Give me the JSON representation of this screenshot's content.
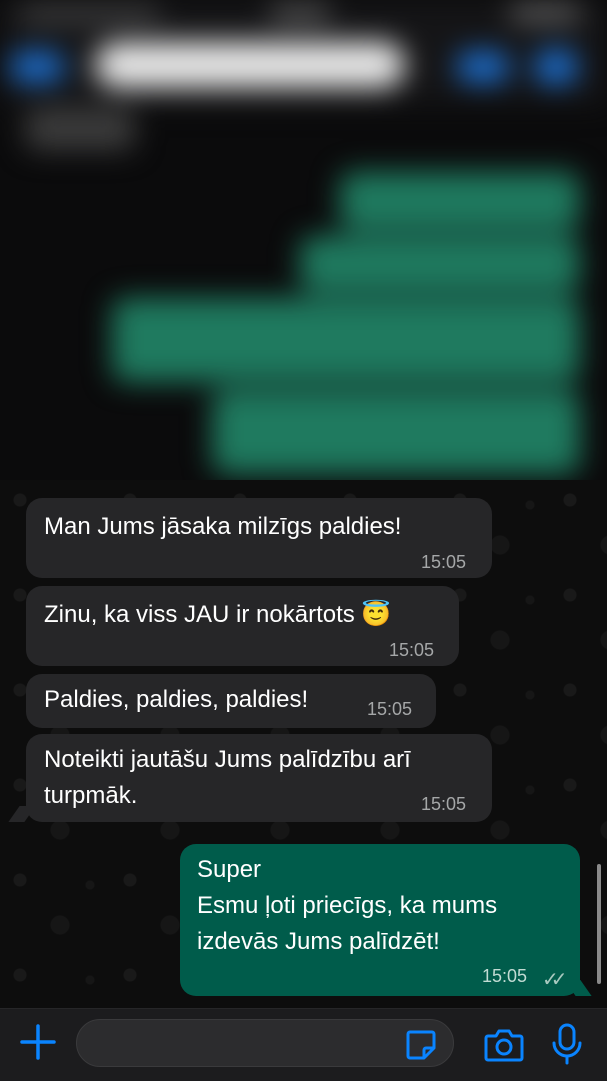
{
  "header": {
    "contact_name": "██████████",
    "contact_status": ""
  },
  "messages": [
    {
      "direction": "incoming",
      "text": "Man Jums jāsaka milzīgs paldies!",
      "time": "15:05"
    },
    {
      "direction": "incoming",
      "text": "Zinu, ka viss JAU ir nokārtots 😇",
      "time": "15:05"
    },
    {
      "direction": "incoming",
      "text": "Paldies, paldies, paldies!",
      "time": "15:05"
    },
    {
      "direction": "incoming",
      "text": "Noteikti jautāšu Jums palīdzību arī\nturpmāk.",
      "time": "15:05"
    },
    {
      "direction": "outgoing",
      "text": "Super\nEsmu ļoti priecīgs, ka mums\nizdevās Jums palīdzēt!",
      "time": "15:05",
      "status": "read"
    }
  ],
  "input": {
    "value": "",
    "placeholder": ""
  },
  "icons": {
    "add": "plus-icon",
    "sticker": "sticker-icon",
    "camera": "camera-icon",
    "microphone": "microphone-icon",
    "read_receipt": "double-check-icon"
  },
  "colors": {
    "accent": "#0a84ff",
    "outgoing_bubble": "#005c4b",
    "incoming_bubble": "#262628",
    "background": "#0b0b0c"
  }
}
